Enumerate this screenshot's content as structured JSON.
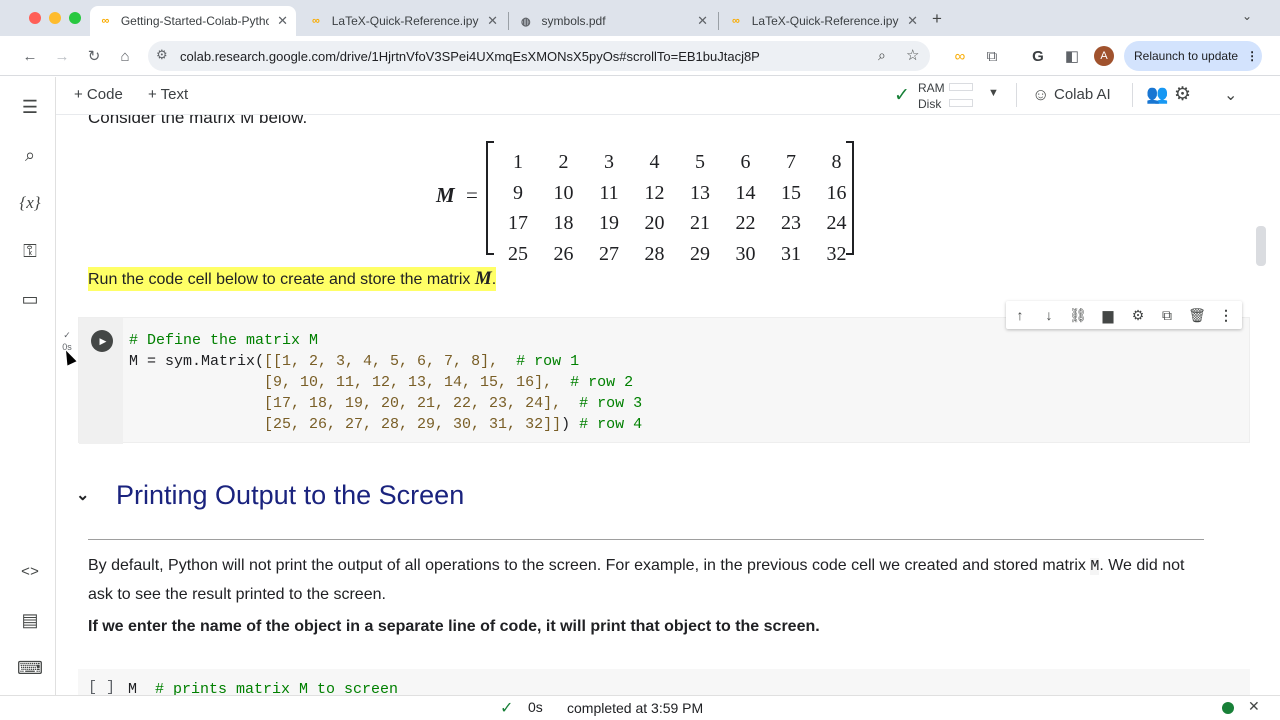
{
  "browser": {
    "tabs": [
      {
        "title": "Getting-Started-Colab-Pytho",
        "active": true
      },
      {
        "title": "LaTeX-Quick-Reference.ipynb",
        "active": false
      },
      {
        "title": "symbols.pdf",
        "active": false
      },
      {
        "title": "LaTeX-Quick-Reference.ipynb",
        "active": false
      }
    ],
    "url": "colab.research.google.com/drive/1HjrtnVfoV3SPei4UXmqEsXMONsX5pyOs#scrollTo=EB1buJtacj8P",
    "relaunch_label": "Relaunch to update",
    "profile_initial": "A"
  },
  "colab_toolbar": {
    "code_label": "+ Code",
    "text_label": "+ Text",
    "ram_label": "RAM",
    "disk_label": "Disk",
    "colab_ai_label": "Colab AI"
  },
  "notebook": {
    "cut_text": "Consider the matrix M below.",
    "matrix": {
      "label": "M",
      "equals": "=",
      "rows": [
        [
          "1",
          "2",
          "3",
          "4",
          "5",
          "6",
          "7",
          "8"
        ],
        [
          "9",
          "10",
          "11",
          "12",
          "13",
          "14",
          "15",
          "16"
        ],
        [
          "17",
          "18",
          "19",
          "20",
          "21",
          "22",
          "23",
          "24"
        ],
        [
          "25",
          "26",
          "27",
          "28",
          "29",
          "30",
          "31",
          "32"
        ]
      ]
    },
    "highlight_text": "Run the code cell below to create and store the matrix ",
    "highlight_math": "M",
    "highlight_end": ".",
    "code_cell_status": {
      "check": "✓",
      "time": "0s"
    },
    "code_lines": {
      "l1": "# Define the matrix M",
      "l2a": "M = sym.Matrix(",
      "l2b": "[[1, 2, 3, 4, 5, 6, 7, 8],",
      "l2c": "  # row 1",
      "l3a": "               [9, 10, 11, 12, 13, 14, 15, 16],",
      "l3b": "  # row 2",
      "l4a": "               [17, 18, 19, 20, 21, 22, 23, 24],",
      "l4b": "  # row 3",
      "l5a": "               [25, 26, 27, 28, 29, 30, 31, 32]]",
      "l5b": ")",
      "l5c": " # row 4"
    },
    "section_title": "Printing Output to the Screen",
    "para1a": "By default, Python will not print the output of all operations to the screen. For example, in the previous code cell we created and stored matrix ",
    "para1_code": "M",
    "para1b": ". We did not ask to see the result printed to the screen.",
    "bold_para": "If we enter the name of the object in a separate line of code, it will print that object to the screen.",
    "code2_bracket": "[ ]",
    "code2_code": "M",
    "code2_comment": "  # prints matrix M to screen"
  },
  "statusbar": {
    "check": "✓",
    "time": "0s",
    "completed": "completed at 3:59 PM"
  }
}
